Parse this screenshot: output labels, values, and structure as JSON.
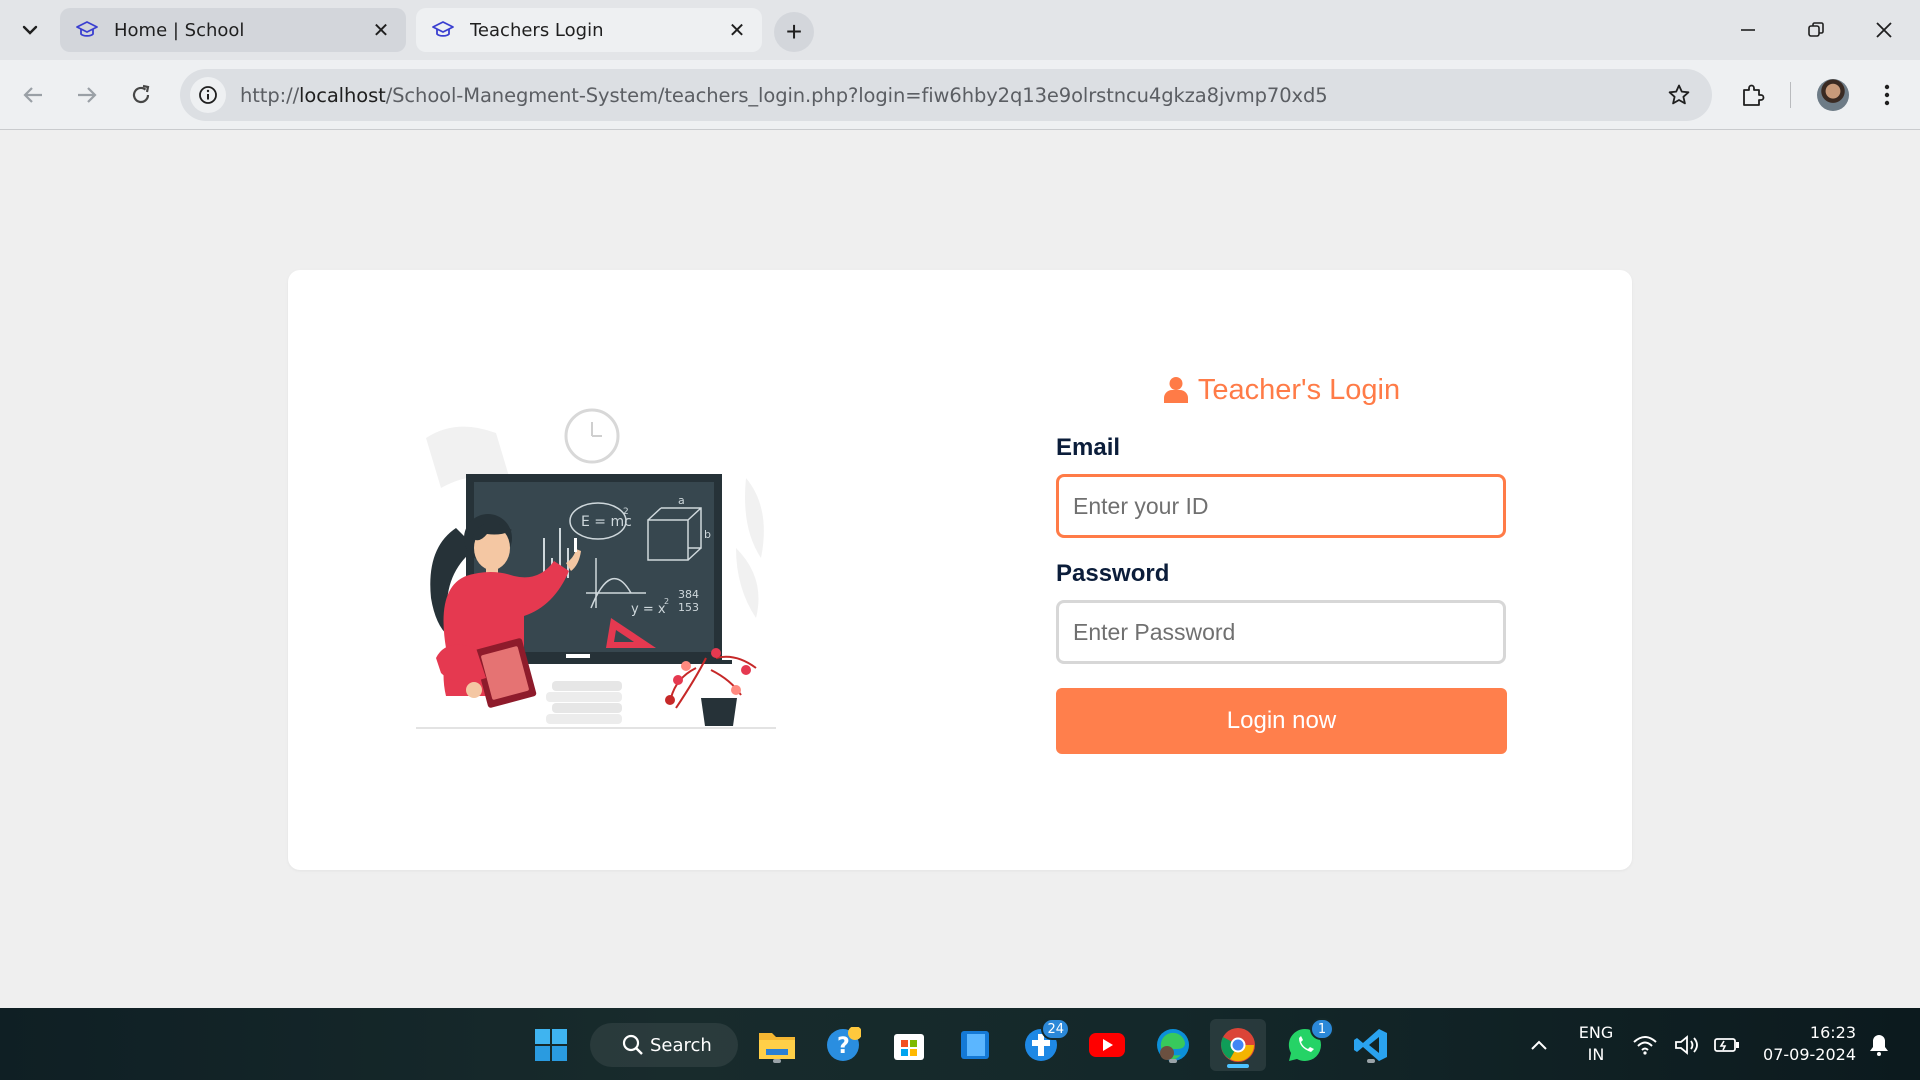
{
  "browser": {
    "tabs": [
      {
        "title": "Home | School",
        "active": false
      },
      {
        "title": "Teachers Login",
        "active": true
      }
    ],
    "url_prefix": "http://",
    "url_host": "localhost",
    "url_path": "/School-Manegment-System/teachers_login.php?login=fiw6hby2q13e9olrstncu4gkza8jvmp70xd5"
  },
  "login": {
    "title": "Teacher's Login",
    "email_label": "Email",
    "email_placeholder": "Enter your ID",
    "password_label": "Password",
    "password_placeholder": "Enter Password",
    "button_label": "Login now"
  },
  "illustration": {
    "formula_1": "E = mc",
    "formula_1_exp": "2",
    "formula_2": "y = x",
    "formula_2_exp": "2",
    "numbers_top": "384",
    "numbers_bottom": "153",
    "cube_label_a": "a",
    "cube_label_b": "b"
  },
  "taskbar": {
    "search_label": "Search",
    "lang_top": "ENG",
    "lang_bottom": "IN",
    "time": "16:23",
    "date": "07-09-2024",
    "edge_badge": "24",
    "whatsapp_badge": "1",
    "icons": [
      "windows-start-icon",
      "search-icon",
      "file-explorer-icon",
      "help-icon",
      "microsoft-store-icon",
      "notes-icon",
      "cross-app-icon",
      "youtube-icon",
      "edge-icon",
      "chrome-icon",
      "whatsapp-icon",
      "vscode-icon"
    ]
  },
  "colors": {
    "accent": "#ff7f4c",
    "label": "#0b1d3a",
    "page_bg": "#efefef"
  }
}
